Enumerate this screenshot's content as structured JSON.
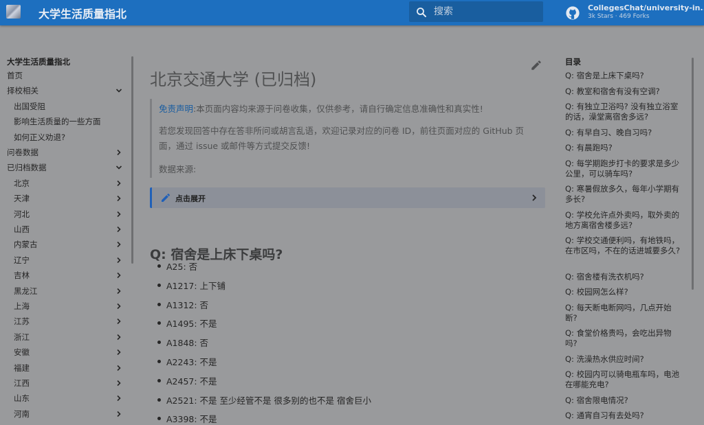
{
  "header": {
    "site_title": "大学生活质量指北",
    "search_placeholder": "搜索",
    "repo_name": "CollegesChat/university-in...",
    "repo_stats": "3k Stars · 469 Forks"
  },
  "nav": {
    "title": "大学生活质量指北",
    "items": [
      {
        "label": "首页",
        "indent": false,
        "chevron": ""
      },
      {
        "label": "择校相关",
        "indent": false,
        "chevron": "down"
      },
      {
        "label": "出国受阻",
        "indent": true,
        "chevron": ""
      },
      {
        "label": "影响生活质量的一些方面",
        "indent": true,
        "chevron": ""
      },
      {
        "label": "如何正义劝退?",
        "indent": true,
        "chevron": ""
      },
      {
        "label": "问卷数据",
        "indent": false,
        "chevron": "right"
      },
      {
        "label": "已归档数据",
        "indent": false,
        "chevron": "down"
      },
      {
        "label": "北京",
        "indent": true,
        "chevron": "right"
      },
      {
        "label": "天津",
        "indent": true,
        "chevron": "right"
      },
      {
        "label": "河北",
        "indent": true,
        "chevron": "right"
      },
      {
        "label": "山西",
        "indent": true,
        "chevron": "right"
      },
      {
        "label": "内蒙古",
        "indent": true,
        "chevron": "right"
      },
      {
        "label": "辽宁",
        "indent": true,
        "chevron": "right"
      },
      {
        "label": "吉林",
        "indent": true,
        "chevron": "right"
      },
      {
        "label": "黑龙江",
        "indent": true,
        "chevron": "right"
      },
      {
        "label": "上海",
        "indent": true,
        "chevron": "right"
      },
      {
        "label": "江苏",
        "indent": true,
        "chevron": "right"
      },
      {
        "label": "浙江",
        "indent": true,
        "chevron": "right"
      },
      {
        "label": "安徽",
        "indent": true,
        "chevron": "right"
      },
      {
        "label": "福建",
        "indent": true,
        "chevron": "right"
      },
      {
        "label": "江西",
        "indent": true,
        "chevron": "right"
      },
      {
        "label": "山东",
        "indent": true,
        "chevron": "right"
      },
      {
        "label": "河南",
        "indent": true,
        "chevron": "right"
      }
    ]
  },
  "main": {
    "page_title": "北京交通大学 (已归档)",
    "note": {
      "disclaimer_label": "免责声明",
      "disclaimer_text": ":本页面内容均来源于问卷收集，仅供参考，请自行确定信息准确性和真实性!",
      "report_line1": "若您发现回答中存在答非所问或胡言乱语，欢迎记录对应的问卷 ID，前往页面对应的 GitHub 页",
      "report_line2": "面，通过 issue 或邮件等方式提交反馈!",
      "source_label": "数据来源:"
    },
    "expand_label": "点击展开",
    "question": "Q: 宿舍是上床下桌吗?",
    "answers": [
      "A25: 否",
      "A1217: 上下铺",
      "A1312: 否",
      "A1495: 不是",
      "A1848: 否",
      "A2243: 不是",
      "A2457: 不是",
      "A2521: 不是 至少经管不是 很多别的也不是 宿舍巨小",
      "A3398: 不是"
    ]
  },
  "toc": {
    "title": "目录",
    "items": [
      "Q: 宿舍是上床下桌吗?",
      "Q: 教室和宿舍有没有空调?",
      "Q: 有独立卫浴吗? 没有独立浴室的话，澡堂离宿舍多远?",
      "Q: 有早自习、晚自习吗?",
      "Q: 有晨跑吗?",
      "Q: 每学期跑步打卡的要求是多少公里，可以骑车吗?",
      "Q: 寒暑假放多久，每年小学期有多长?",
      "Q: 学校允许点外卖吗，取外卖的地方离宿舍楼多远?",
      "Q: 学校交通便利吗，有地铁吗，在市区吗，不在的话进城要多久?",
      "Q: 宿舍楼有洗衣机吗?",
      "Q: 校园网怎么样?",
      "Q: 每天断电断网吗，几点开始断?",
      "Q: 食堂价格贵吗，会吃出异物吗?",
      "Q: 洗澡热水供应时间?",
      "Q: 校园内可以骑电瓶车吗，电池在哪能充电?",
      "Q: 宿舍限电情况?",
      "Q: 通宵自习有去处吗?"
    ]
  }
}
